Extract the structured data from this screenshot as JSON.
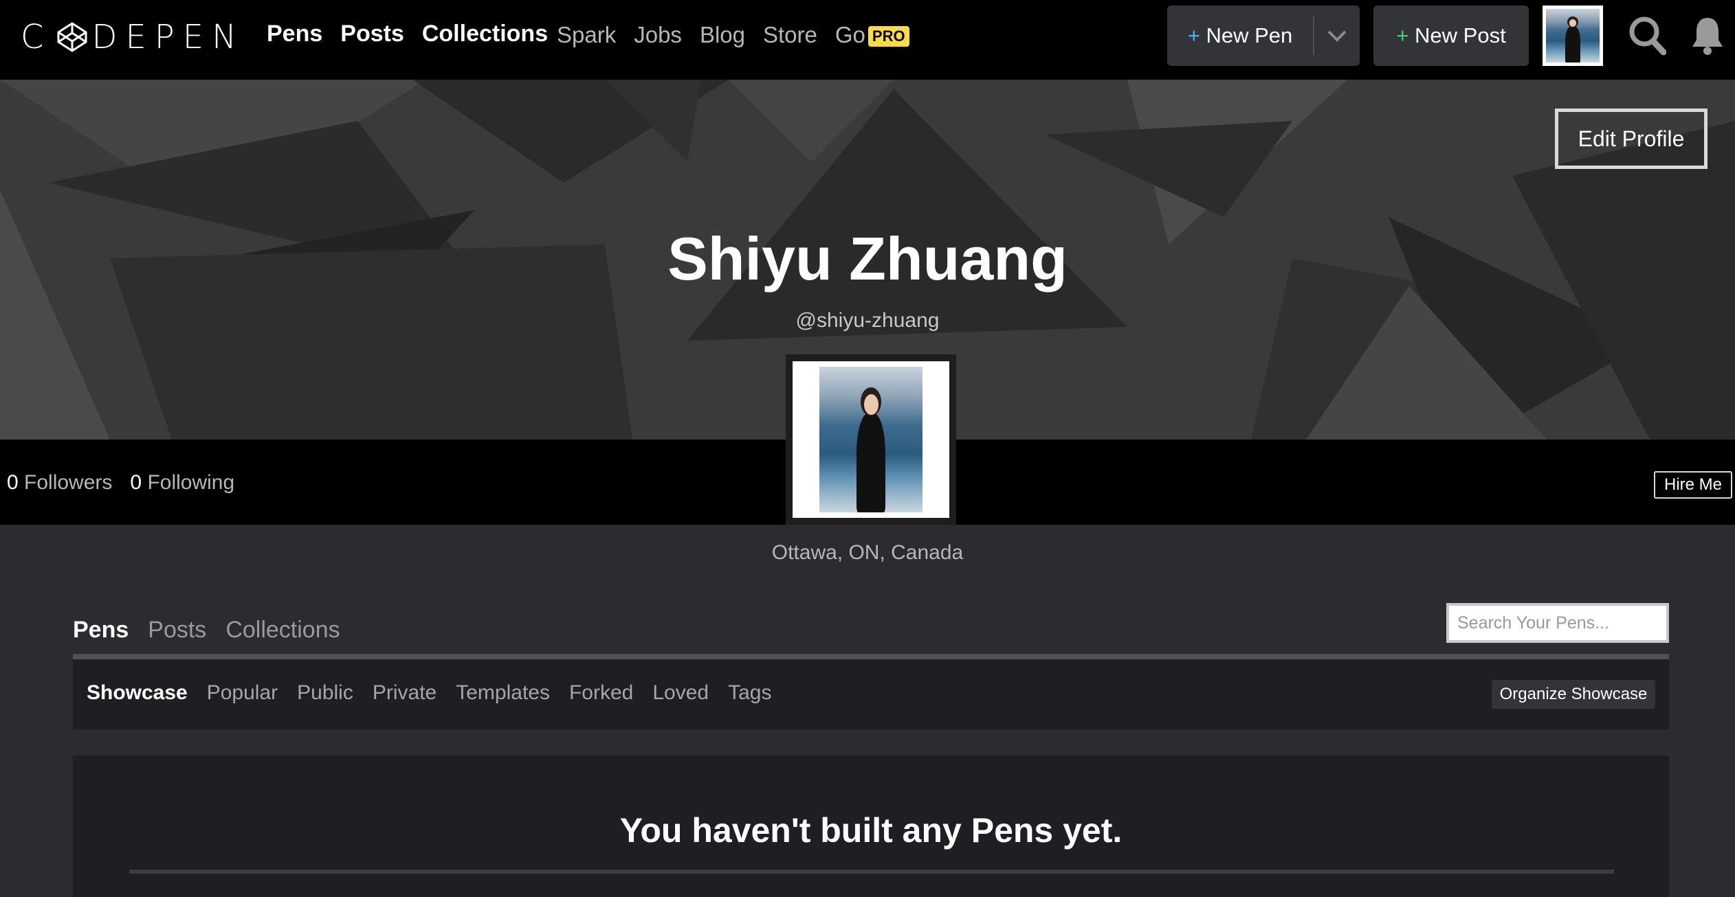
{
  "header": {
    "logo": "CODEPEN",
    "nav_primary": [
      "Pens",
      "Posts",
      "Collections"
    ],
    "nav_secondary": [
      "Spark",
      "Jobs",
      "Blog",
      "Store",
      "Go"
    ],
    "pro_badge": "PRO",
    "new_pen": "New Pen",
    "new_post": "New Post",
    "plus": "+"
  },
  "profile": {
    "edit_profile": "Edit Profile",
    "name": "Shiyu Zhuang",
    "handle": "@shiyu-zhuang",
    "followers_count": "0",
    "followers_label": "Followers",
    "following_count": "0",
    "following_label": "Following",
    "hire_me": "Hire Me",
    "location": "Ottawa, ON, Canada"
  },
  "tabs": {
    "items": [
      "Pens",
      "Posts",
      "Collections"
    ],
    "active": "Pens",
    "search_placeholder": "Search Your Pens..."
  },
  "subnav": {
    "items": [
      "Showcase",
      "Popular",
      "Public",
      "Private",
      "Templates",
      "Forked",
      "Loved",
      "Tags"
    ],
    "active": "Showcase",
    "organize": "Organize Showcase"
  },
  "empty_state": {
    "message": "You haven't built any Pens yet."
  },
  "colors": {
    "topbar": "#000000",
    "page_bg": "#2c2c30",
    "panel_bg": "#1e1f23",
    "pro_badge": "#ffdd40"
  },
  "icons": [
    "codepen-logo-icon",
    "chevron-down-icon",
    "search-icon",
    "bell-icon"
  ]
}
